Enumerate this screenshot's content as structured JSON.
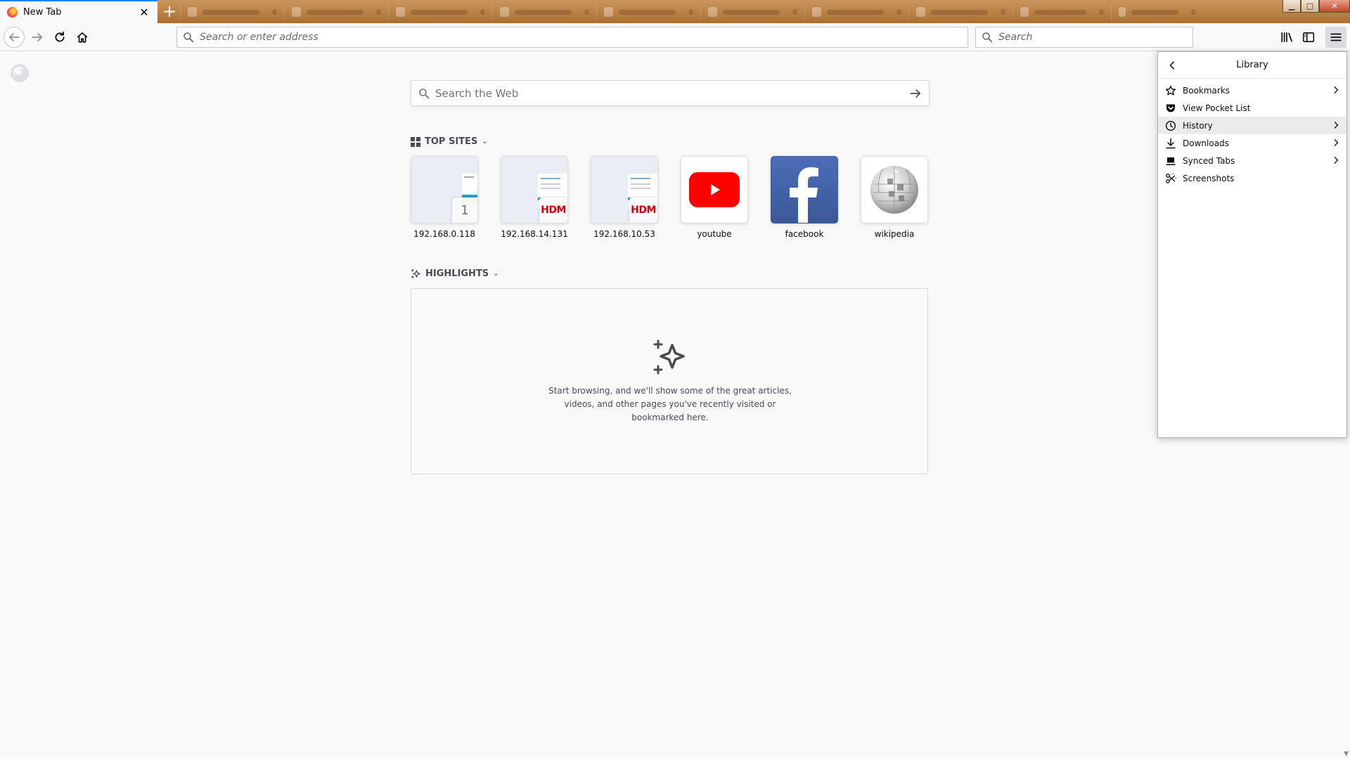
{
  "tabs": {
    "active": {
      "title": "New Tab",
      "close": "✕"
    },
    "new_tab": "+",
    "window_controls": {
      "minimize": "▁",
      "maximize": "□",
      "close": "✕"
    }
  },
  "navbar": {
    "address_placeholder": "Search or enter address",
    "search_placeholder": "Search"
  },
  "page": {
    "web_search_placeholder": "Search the Web",
    "top_sites_title": "TOP SITES",
    "top_sites": [
      {
        "label": "192.168.0.118",
        "badge": "1"
      },
      {
        "label": "192.168.14.131",
        "badge": "HDM"
      },
      {
        "label": "192.168.10.53",
        "badge": "HDM"
      },
      {
        "label": "youtube"
      },
      {
        "label": "facebook"
      },
      {
        "label": "wikipedia"
      }
    ],
    "highlights_title": "HIGHLIGHTS",
    "highlights_empty": "Start browsing, and we'll show some of the great articles, videos, and other pages you've recently visited or bookmarked here."
  },
  "library_panel": {
    "title": "Library",
    "items": [
      {
        "label": "Bookmarks",
        "icon": "star-icon",
        "submenu": true
      },
      {
        "label": "View Pocket List",
        "icon": "pocket-icon",
        "submenu": false
      },
      {
        "label": "History",
        "icon": "clock-icon",
        "submenu": true,
        "hovered": true
      },
      {
        "label": "Downloads",
        "icon": "download-icon",
        "submenu": true
      },
      {
        "label": "Synced Tabs",
        "icon": "laptop-icon",
        "submenu": true
      },
      {
        "label": "Screenshots",
        "icon": "scissors-icon",
        "submenu": false
      }
    ]
  },
  "colors": {
    "accent": "#0a84ff",
    "youtube_red": "#ff0000",
    "facebook_blue": "#3b5998",
    "hdm_red": "#d7000f"
  }
}
